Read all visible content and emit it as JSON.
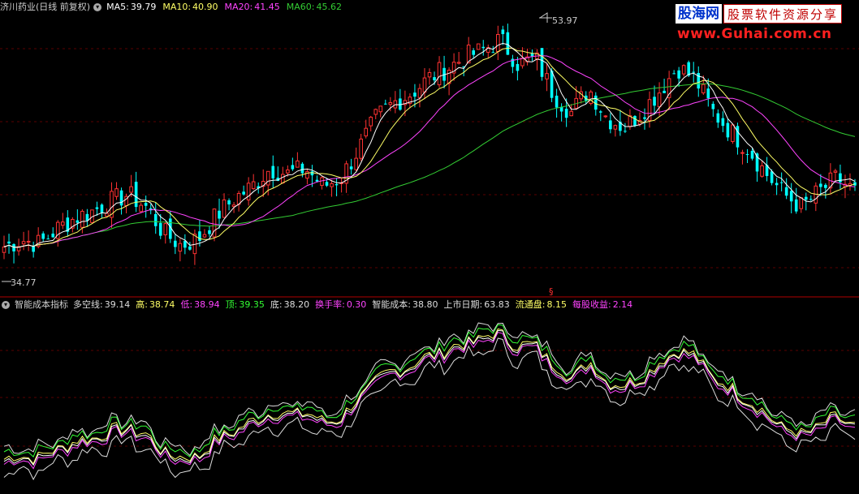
{
  "main_panel": {
    "stock_title": "济川药业(日线 前复权)",
    "ma": [
      {
        "label": "MA5:",
        "value": "39.79",
        "color": "#ffffff"
      },
      {
        "label": "MA10:",
        "value": "40.90",
        "color": "#ffff66"
      },
      {
        "label": "MA20:",
        "value": "41.45",
        "color": "#ff44ff"
      },
      {
        "label": "MA60:",
        "value": "45.62",
        "color": "#33cc33"
      }
    ],
    "high_marker": "53.97",
    "low_marker": "34.77",
    "divider_marker": "§"
  },
  "sub_panel": {
    "indicator_name": "智能成本指标",
    "values": [
      {
        "label": "多空线:",
        "value": "39.14",
        "color": "#dddddd"
      },
      {
        "label": "高:",
        "value": "38.74",
        "color": "#ffff66"
      },
      {
        "label": "低:",
        "value": "38.94",
        "color": "#ff44ff"
      },
      {
        "label": "顶:",
        "value": "39.35",
        "color": "#33ff33"
      },
      {
        "label": "底:",
        "value": "38.20",
        "color": "#dddddd"
      },
      {
        "label": "换手率:",
        "value": "0.30",
        "color": "#ff44ff"
      },
      {
        "label": "智能成本:",
        "value": "38.80",
        "color": "#dddddd"
      },
      {
        "label": "上市日期:",
        "value": "63.83",
        "color": "#dddddd"
      },
      {
        "label": "流通盘:",
        "value": "8.15",
        "color": "#ffff66"
      },
      {
        "label": "每股收益:",
        "value": "2.14",
        "color": "#ff44ff"
      }
    ]
  },
  "watermark": {
    "brand": "股海网",
    "tagline": "股票软件资源分享",
    "url": "www.Guhai.com.cn"
  },
  "chart_data": {
    "type": "line",
    "price_range": [
      34.77,
      53.97
    ],
    "series_colors": {
      "up": "#ff3232",
      "down": "#00ffff",
      "ma5": "#ffffff",
      "ma10": "#ffff66",
      "ma20": "#ff44ff",
      "ma60": "#33cc33"
    },
    "close_path": [
      37.3,
      37.8,
      37.5,
      38.6,
      39.4,
      39.9,
      40.6,
      41.1,
      40.2,
      38.3,
      37.4,
      37.9,
      39.6,
      40.8,
      41.7,
      43.0,
      42.6,
      43.0,
      41.7,
      42.3,
      44.4,
      46.7,
      47.8,
      48.5,
      49.6,
      50.3,
      51.1,
      51.6,
      52.4,
      50.6,
      51.0,
      48.4,
      47.1,
      48.8,
      46.7,
      46.0,
      47.2,
      48.7,
      50.4,
      49.5,
      47.1,
      45.7,
      44.4,
      42.6,
      41.1,
      40.2,
      41.3,
      42.3,
      41.3
    ]
  }
}
